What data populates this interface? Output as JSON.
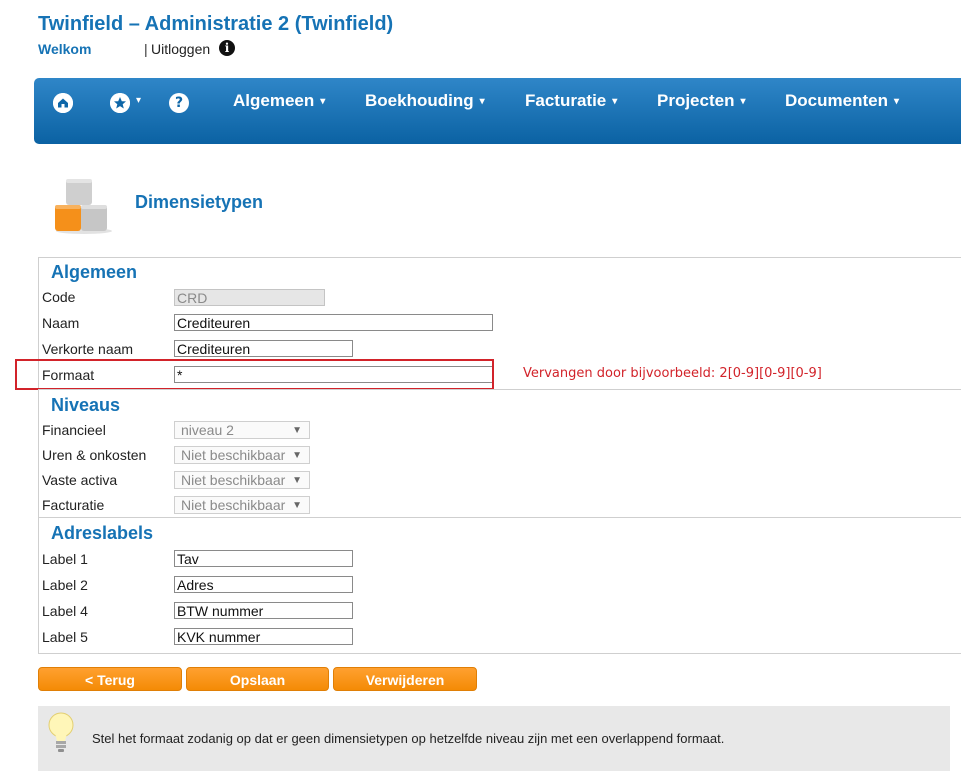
{
  "header": {
    "title": "Twinfield – Administratie 2 (Twinfield)",
    "welcome": "Welkom",
    "separator": "|",
    "logout": "Uitloggen",
    "info_glyph": "i"
  },
  "nav": {
    "icons": [
      "home-icon",
      "star-icon",
      "help-icon"
    ],
    "help_glyph": "?",
    "items": [
      {
        "label": "Algemeen"
      },
      {
        "label": "Boekhouding"
      },
      {
        "label": "Facturatie"
      },
      {
        "label": "Projecten"
      },
      {
        "label": "Documenten"
      }
    ],
    "caret": "▾"
  },
  "page": {
    "title": "Dimensietypen"
  },
  "sections": {
    "algemeen": {
      "heading": "Algemeen",
      "code_label": "Code",
      "code_value": "CRD",
      "naam_label": "Naam",
      "naam_value": "Crediteuren",
      "verkort_label": "Verkorte naam",
      "verkort_value": "Crediteuren",
      "formaat_label": "Formaat",
      "formaat_value": "*"
    },
    "niveaus": {
      "heading": "Niveaus",
      "rows": [
        {
          "label": "Financieel",
          "value": "niveau 2"
        },
        {
          "label": "Uren & onkosten",
          "value": "Niet beschikbaar"
        },
        {
          "label": "Vaste activa",
          "value": "Niet beschikbaar"
        },
        {
          "label": "Facturatie",
          "value": "Niet beschikbaar"
        }
      ],
      "arrow": "▼"
    },
    "adreslabels": {
      "heading": "Adreslabels",
      "rows": [
        {
          "label": "Label 1",
          "value": "Tav"
        },
        {
          "label": "Label 2",
          "value": "Adres"
        },
        {
          "label": "Label 4",
          "value": "BTW nummer"
        },
        {
          "label": "Label 5",
          "value": "KVK nummer"
        }
      ]
    }
  },
  "annotation": "Vervangen door bijvoorbeeld: 2[0-9][0-9][0-9]",
  "buttons": {
    "back": "< Terug",
    "save": "Opslaan",
    "delete": "Verwijderen"
  },
  "tip": {
    "text": "Stel het formaat zodanig op dat er geen dimensietypen op hetzelfde niveau zijn met een overlappend formaat."
  },
  "colors": {
    "brand_blue": "#1673b5",
    "nav_blue": "#0b62a3",
    "button_orange": "#f48b05",
    "annotation_red": "#d2232a"
  }
}
